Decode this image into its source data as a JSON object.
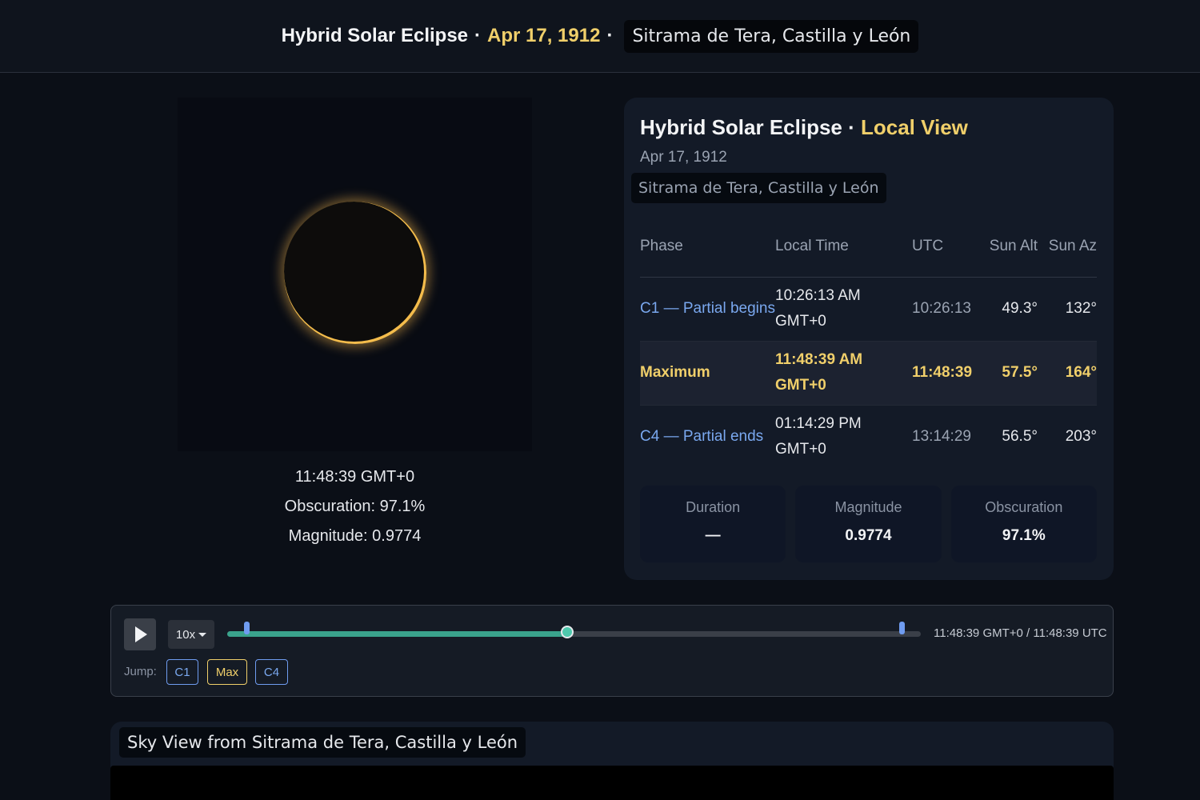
{
  "header": {
    "title": "Hybrid Solar Eclipse",
    "separator": "·",
    "date": "Apr 17, 1912",
    "location": "Sitrama de Tera, Castilla y León"
  },
  "sun_view": {
    "time": "11:48:39 GMT+0",
    "obscuration": "Obscuration: 97.1%",
    "magnitude": "Magnitude: 0.9774"
  },
  "panel": {
    "title": "Hybrid Solar Eclipse",
    "title_sep": " · ",
    "title_accent": "Local View",
    "date": "Apr 17, 1912",
    "location": "Sitrama de Tera, Castilla y León",
    "columns": [
      "Phase",
      "Local Time",
      "UTC",
      "Sun Alt",
      "Sun Az"
    ],
    "rows": [
      {
        "phase": "C1 — Partial begins",
        "local": "10:26:13 AM GMT+0",
        "utc": "10:26:13",
        "alt": "49.3°",
        "az": "132°"
      },
      {
        "phase": "Maximum",
        "local": "11:48:39 AM GMT+0",
        "utc": "11:48:39",
        "alt": "57.5°",
        "az": "164°"
      },
      {
        "phase": "C4 — Partial ends",
        "local": "01:14:29 PM GMT+0",
        "utc": "13:14:29",
        "alt": "56.5°",
        "az": "203°"
      }
    ],
    "metrics": [
      {
        "label": "Duration",
        "value": "—"
      },
      {
        "label": "Magnitude",
        "value": "0.9774"
      },
      {
        "label": "Obscuration",
        "value": "97.1%"
      }
    ]
  },
  "player": {
    "speed": "10x",
    "progress": 0.49,
    "c1_marker": 0.028,
    "c4_marker": 0.972,
    "time_readout": "11:48:39 GMT+0 / 11:48:39 UTC",
    "jump_label": "Jump:",
    "jump_buttons": [
      "C1",
      "Max",
      "C4"
    ],
    "colors": {
      "fill": "#3aa38c",
      "marker": "#6f9cf0",
      "max": "#f0cf6a"
    }
  },
  "sky": {
    "title": "Sky View from Sitrama de Tera, Castilla y León"
  }
}
